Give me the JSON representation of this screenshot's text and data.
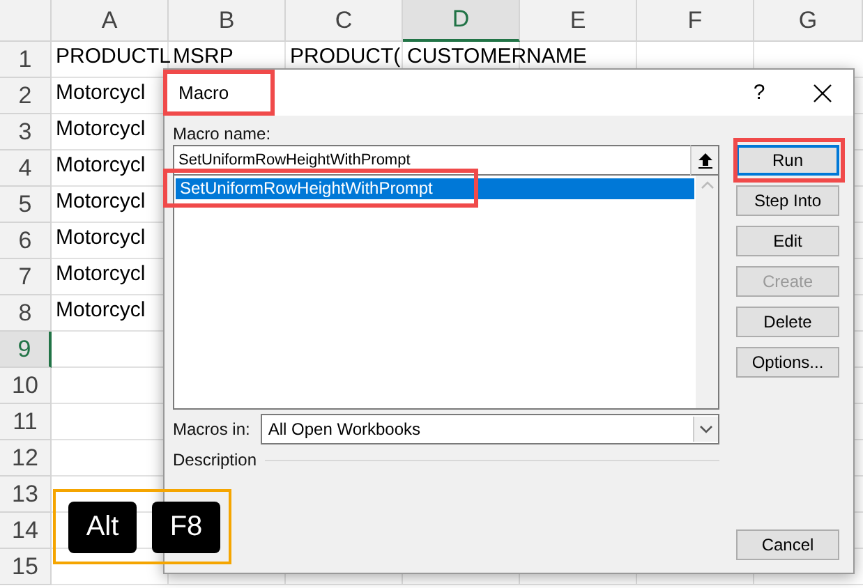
{
  "sheet": {
    "columns": [
      {
        "label": "A",
        "selected": false
      },
      {
        "label": "B",
        "selected": false
      },
      {
        "label": "C",
        "selected": false
      },
      {
        "label": "D",
        "selected": true
      },
      {
        "label": "E",
        "selected": false
      },
      {
        "label": "F",
        "selected": false
      },
      {
        "label": "G",
        "selected": false
      }
    ],
    "rows": [
      {
        "label": "1",
        "selected": false,
        "cells": [
          "PRODUCTL",
          "MSRP",
          "PRODUCT(",
          "CUSTOMERNAME"
        ]
      },
      {
        "label": "2",
        "selected": false,
        "cells": [
          "Motorcycl"
        ]
      },
      {
        "label": "3",
        "selected": false,
        "cells": [
          "Motorcycl"
        ]
      },
      {
        "label": "4",
        "selected": false,
        "cells": [
          "Motorcycl"
        ]
      },
      {
        "label": "5",
        "selected": false,
        "cells": [
          "Motorcycl"
        ]
      },
      {
        "label": "6",
        "selected": false,
        "cells": [
          "Motorcycl"
        ]
      },
      {
        "label": "7",
        "selected": false,
        "cells": [
          "Motorcycl"
        ]
      },
      {
        "label": "8",
        "selected": false,
        "cells": [
          "Motorcycl"
        ]
      },
      {
        "label": "9",
        "selected": true,
        "cells": []
      },
      {
        "label": "10",
        "selected": false,
        "cells": []
      },
      {
        "label": "11",
        "selected": false,
        "cells": []
      },
      {
        "label": "12",
        "selected": false,
        "cells": []
      },
      {
        "label": "13",
        "selected": false,
        "cells": []
      },
      {
        "label": "14",
        "selected": false,
        "cells": []
      },
      {
        "label": "15",
        "selected": false,
        "cells": []
      }
    ]
  },
  "dialog": {
    "title": "Macro",
    "help": "?",
    "name_label": "Macro name:",
    "name_value": "SetUniformRowHeightWithPrompt",
    "macros": [
      {
        "label": "SetUniformRowHeightWithPrompt",
        "selected": true
      }
    ],
    "buttons": [
      {
        "label": "Run",
        "disabled": false,
        "focused": true
      },
      {
        "label": "Step Into",
        "disabled": false,
        "focused": false
      },
      {
        "label": "Edit",
        "disabled": false,
        "focused": false
      },
      {
        "label": "Create",
        "disabled": true,
        "focused": false
      },
      {
        "label": "Delete",
        "disabled": false,
        "focused": false
      },
      {
        "label": "Options...",
        "disabled": false,
        "focused": false
      }
    ],
    "macros_in_label": "Macros in:",
    "macros_in_value": "All Open Workbooks",
    "description_label": "Description",
    "cancel": "Cancel"
  },
  "keys": [
    "Alt",
    "F8"
  ]
}
